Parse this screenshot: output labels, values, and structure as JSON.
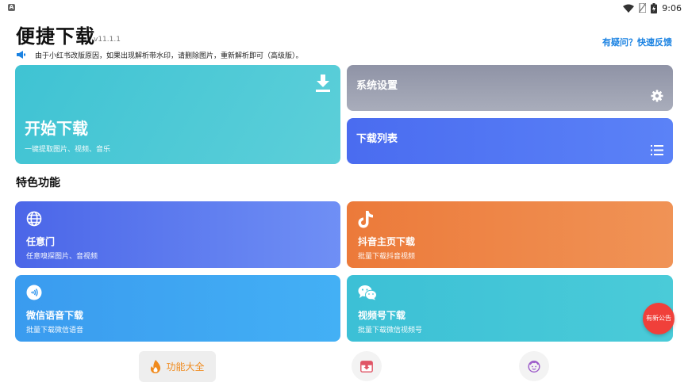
{
  "statusbar": {
    "notification_letter": "A",
    "time": "9:06",
    "icons": [
      "wifi-icon",
      "no-sim-icon",
      "battery-charging-icon"
    ]
  },
  "header": {
    "title": "便捷下载",
    "version": "v11.1.1",
    "feedback_link": "有疑问？快速反馈",
    "notice_icon": "megaphone-icon",
    "notice_text": "由于小红书改版原因，如果出现解析带水印，请删除图片，重新解析即可（高级版）。"
  },
  "top_cards": {
    "start": {
      "title": "开始下载",
      "subtitle": "一键提取图片、视频、音乐",
      "icon": "download-icon"
    },
    "settings": {
      "label": "系统设置",
      "icon": "gear-icon"
    },
    "download_list": {
      "label": "下载列表",
      "icon": "list-icon"
    }
  },
  "features": {
    "section_title": "特色功能",
    "items": [
      {
        "title": "任意门",
        "subtitle": "任意嗅探图片、音视频",
        "icon": "globe-icon"
      },
      {
        "title": "抖音主页下载",
        "subtitle": "批量下载抖音视频",
        "icon": "tiktok-icon"
      },
      {
        "title": "微信语音下载",
        "subtitle": "批量下载微信语音",
        "icon": "voice-icon"
      },
      {
        "title": "视频号下载",
        "subtitle": "批量下载微信视频号",
        "icon": "wechat-icon"
      }
    ]
  },
  "floating_badge": {
    "label": "有新公告"
  },
  "bottom_nav": {
    "items": [
      {
        "label": "功能大全",
        "icon": "flame-icon",
        "active": true
      },
      {
        "label": "",
        "icon": "download-box-icon",
        "active": false
      },
      {
        "label": "",
        "icon": "face-icon",
        "active": false
      }
    ]
  },
  "colors": {
    "accent_blue": "#1a82e2",
    "active_orange": "#f08a1c",
    "badge_red": "#f0403a"
  }
}
